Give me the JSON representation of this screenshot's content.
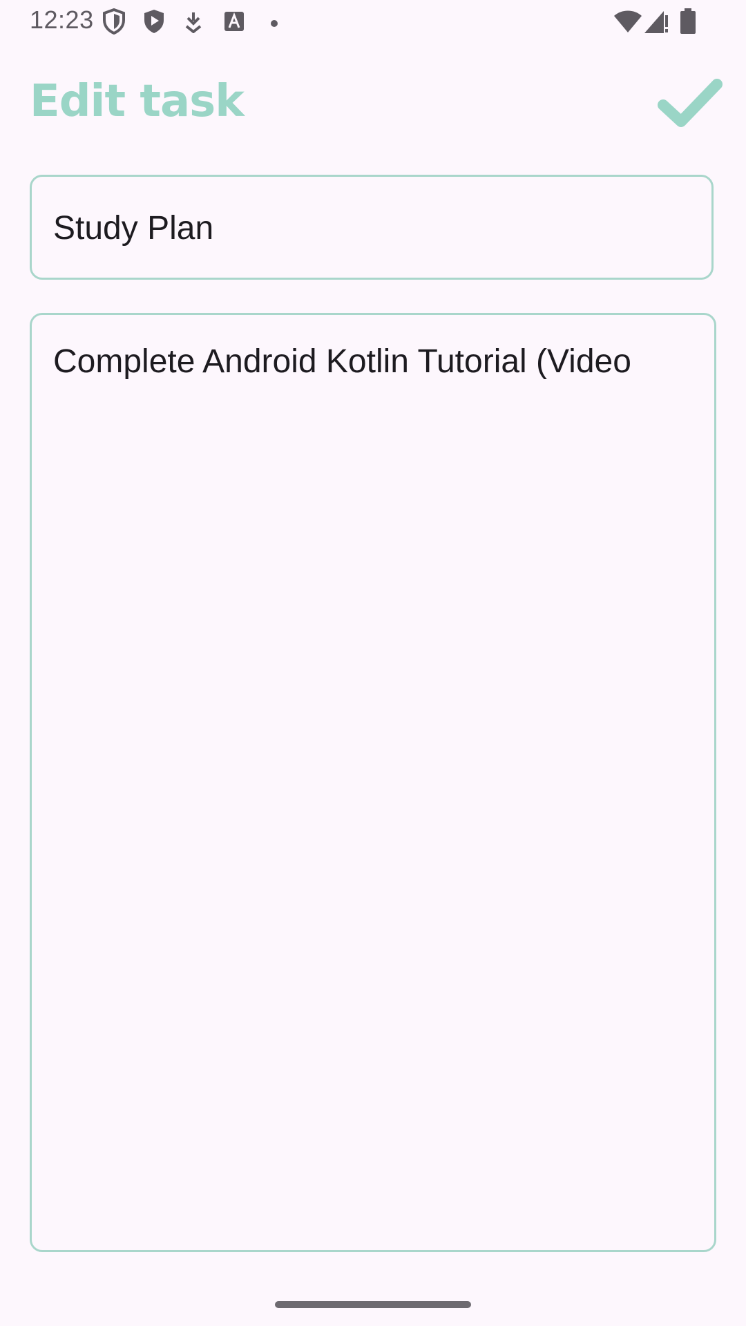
{
  "status_bar": {
    "time": "12:23",
    "left_icons": [
      "shield-outline-icon",
      "shield-play-icon",
      "download-icon",
      "font-a-icon",
      "dot-icon"
    ],
    "right_icons": [
      "wifi-icon",
      "signal-icon",
      "battery-icon"
    ]
  },
  "header": {
    "title": "Edit task",
    "save_icon": "checkmark-icon"
  },
  "form": {
    "title_value": "Study Plan",
    "description_value": "Complete Android Kotlin Tutorial (Video"
  },
  "colors": {
    "accent": "#9ad5c6",
    "border": "#a9d6cb",
    "background": "#fdf7fd",
    "text": "#1d1b20"
  }
}
